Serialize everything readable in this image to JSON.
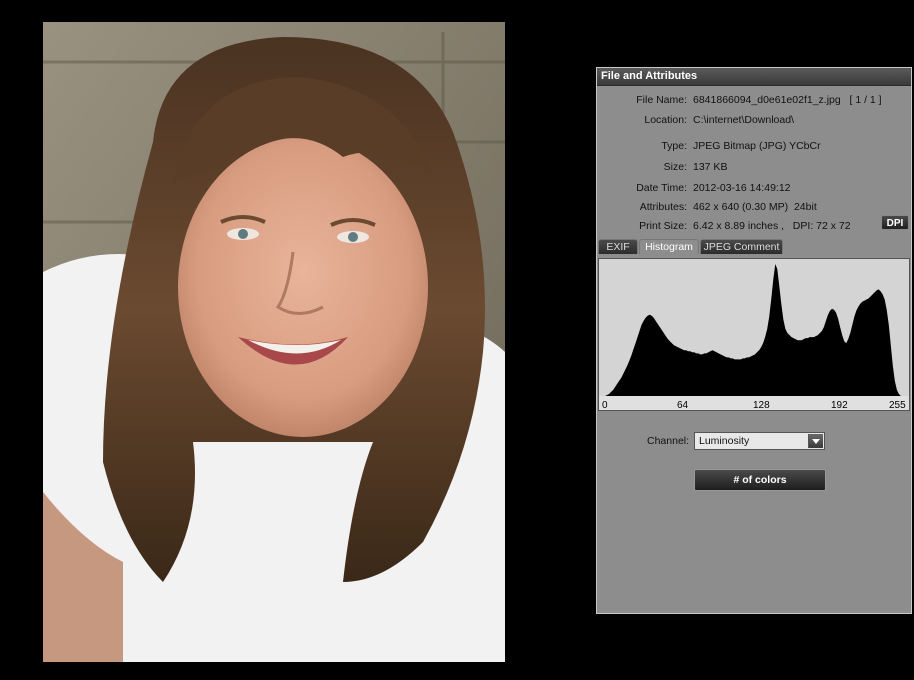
{
  "panel": {
    "title": "File and Attributes",
    "attributes": [
      {
        "label": "File Name:",
        "value": "6841866094_d0e61e02f1_z.jpg   [ 1 / 1 ]"
      },
      {
        "label": "Location:",
        "value": "C:\\internet\\Download\\"
      },
      {
        "label": "Type:",
        "value": "JPEG Bitmap (JPG) YCbCr"
      },
      {
        "label": "Size:",
        "value": "137 KB"
      },
      {
        "label": "Date Time:",
        "value": "2012-03-16 14:49:12"
      },
      {
        "label": "Attributes:",
        "value": "462 x 640 (0.30 MP)  24bit"
      },
      {
        "label": "Print Size:",
        "value": "6.42 x 8.89 inches ,   DPI: 72 x 72"
      }
    ],
    "dpi_button": "DPI",
    "tabs": [
      {
        "label": "EXIF",
        "active": false
      },
      {
        "label": "Histogram",
        "active": true
      },
      {
        "label": "JPEG Comment",
        "active": false
      }
    ],
    "histogram": {
      "axis_ticks": [
        "0",
        "64",
        "128",
        "192",
        "255"
      ],
      "levels": [
        0,
        0,
        0,
        1,
        2,
        4,
        6,
        9,
        12,
        15,
        18,
        22,
        26,
        30,
        35,
        40,
        46,
        52,
        58,
        64,
        70,
        74,
        77,
        79,
        80,
        79,
        77,
        74,
        71,
        68,
        65,
        62,
        59,
        56,
        54,
        52,
        50,
        49,
        48,
        47,
        46,
        45,
        45,
        44,
        44,
        43,
        43,
        42,
        42,
        41,
        41,
        42,
        42,
        43,
        44,
        45,
        44,
        43,
        42,
        41,
        40,
        39,
        38,
        38,
        37,
        37,
        36,
        36,
        36,
        36,
        37,
        37,
        38,
        38,
        39,
        40,
        41,
        43,
        45,
        48,
        52,
        58,
        66,
        78,
        95,
        115,
        130,
        125,
        108,
        90,
        75,
        66,
        62,
        60,
        58,
        57,
        56,
        55,
        55,
        55,
        56,
        57,
        57,
        58,
        58,
        58,
        59,
        60,
        62,
        64,
        68,
        74,
        80,
        84,
        86,
        85,
        82,
        76,
        68,
        60,
        54,
        52,
        56,
        62,
        70,
        78,
        84,
        88,
        91,
        93,
        94,
        95,
        96,
        98,
        100,
        102,
        104,
        105,
        103,
        100,
        95,
        85,
        70,
        50,
        30,
        15,
        6,
        2,
        0,
        0,
        0,
        0
      ]
    },
    "channel": {
      "label": "Channel:",
      "value": "Luminosity"
    },
    "colors_button": "# of colors"
  }
}
